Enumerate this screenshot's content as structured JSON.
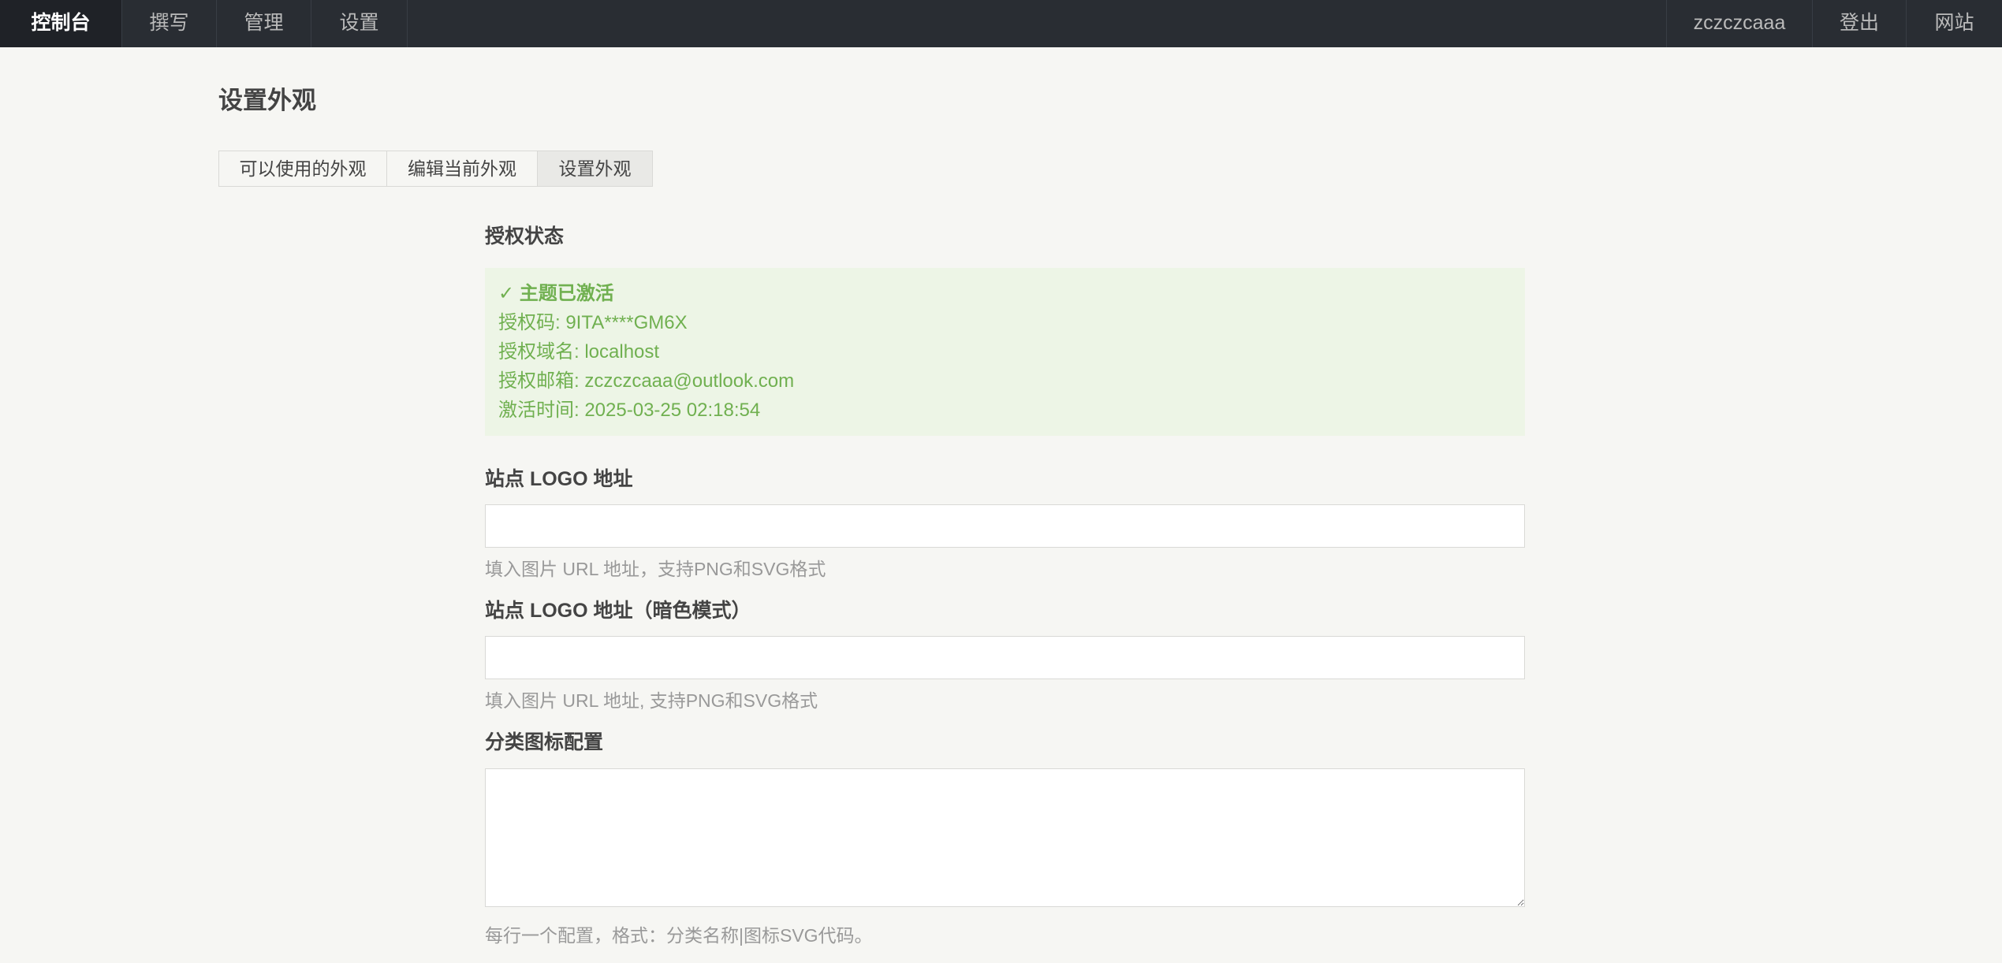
{
  "nav": {
    "left": [
      {
        "label": "控制台",
        "active": true
      },
      {
        "label": "撰写",
        "active": false
      },
      {
        "label": "管理",
        "active": false
      },
      {
        "label": "设置",
        "active": false
      }
    ],
    "right": [
      {
        "label": "zczczcaaa"
      },
      {
        "label": "登出"
      },
      {
        "label": "网站"
      }
    ]
  },
  "page": {
    "title": "设置外观"
  },
  "tabs": [
    {
      "label": "可以使用的外观",
      "active": false
    },
    {
      "label": "编辑当前外观",
      "active": false
    },
    {
      "label": "设置外观",
      "active": true
    }
  ],
  "license": {
    "label": "授权状态",
    "status": "✓ 主题已激活",
    "code": "授权码: 9ITA****GM6X",
    "domain": "授权域名: localhost",
    "email": "授权邮箱: zczczcaaa@outlook.com",
    "activated": "激活时间: 2025-03-25 02:18:54",
    "color": "#70b050",
    "background": "#edf5e6"
  },
  "logo": {
    "label": "站点 LOGO 地址",
    "value": "",
    "desc": "填入图片 URL 地址，支持PNG和SVG格式"
  },
  "logo_dark": {
    "label": "站点 LOGO 地址（暗色模式）",
    "value": "",
    "desc": "填入图片 URL 地址, 支持PNG和SVG格式"
  },
  "category_icons": {
    "label": "分类图标配置",
    "value": "",
    "desc": "每行一个配置，格式：分类名称|图标SVG代码。"
  }
}
